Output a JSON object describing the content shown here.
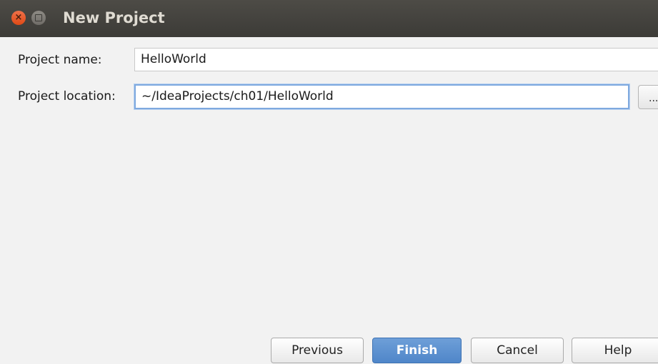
{
  "window": {
    "title": "New Project",
    "close_glyph": "×"
  },
  "form": {
    "name_label": "Project name:",
    "name_value": "HelloWorld",
    "location_label": "Project location:",
    "location_value": "~/IdeaProjects/ch01/HelloWorld",
    "browse_label": "..."
  },
  "buttons": {
    "previous": "Previous",
    "finish": "Finish",
    "cancel": "Cancel",
    "help": "Help"
  },
  "colors": {
    "accent": "#4f86c9",
    "close": "#df4a16",
    "titlebar": "#3c3b37"
  }
}
